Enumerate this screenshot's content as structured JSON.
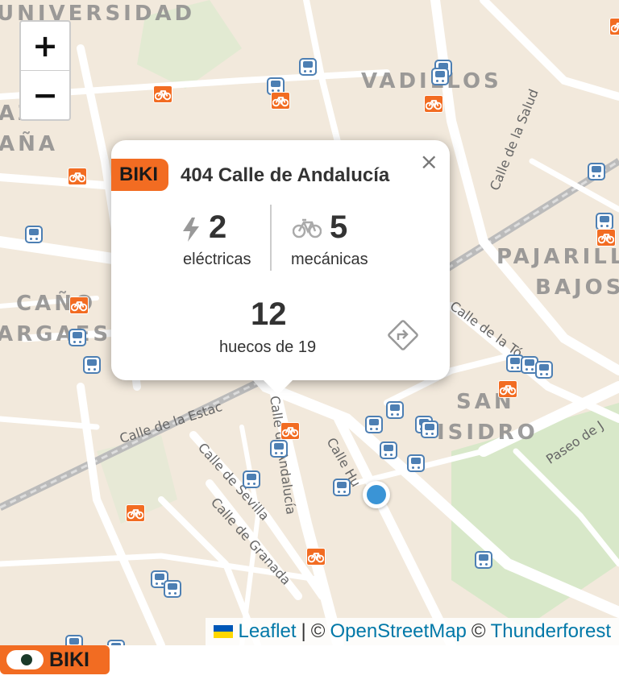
{
  "map": {
    "area_labels": [
      "UNIVERSIDAD",
      "VADILLOS",
      "AZA",
      "AÑA",
      "PAJARILL",
      "BAJOS",
      "CAÑO",
      "ARGAES",
      "SAN",
      "ISIDRO"
    ],
    "street_labels": [
      "Calle de la Salud",
      "Calle de la Tó",
      "Calle de la Estac",
      "Calle de Andalucía",
      "Calle Hu",
      "Calle de Sevilla",
      "Calle de Granada",
      "Paseo de J"
    ]
  },
  "zoom": {
    "in_label": "+",
    "out_label": "−"
  },
  "popup": {
    "badge": "BIKI",
    "title": "404 Calle de Andalucía",
    "close_label": "×",
    "electric_count": "2",
    "electric_label": "eléctricas",
    "mechanical_count": "5",
    "mechanical_label": "mecánicas",
    "free_count": "12",
    "free_label": "huecos de 19",
    "icons": [
      "bolt-icon",
      "bicycle-icon",
      "directions-icon"
    ]
  },
  "attribution": {
    "leaflet": "Leaflet",
    "separator": "|",
    "osm_prefix": "©",
    "osm": "OpenStreetMap",
    "tf_prefix": "©",
    "thunderforest": "Thunderforest"
  },
  "toggle": {
    "label": "BIKI",
    "state": "on"
  },
  "colors": {
    "biki_orange": "#f26c22",
    "bus_blue": "#4d7fb3",
    "link": "#0078a8",
    "map_bg": "#f2e9dc"
  }
}
